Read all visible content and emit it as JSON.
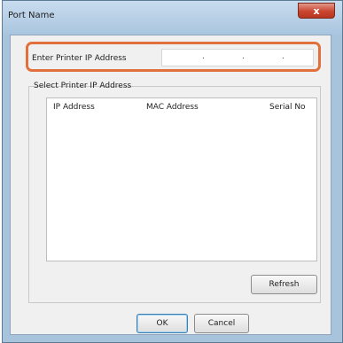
{
  "window": {
    "title": "Port Name",
    "close_glyph": "x"
  },
  "ip_entry": {
    "label": "Enter Printer IP Address",
    "separators": [
      ".",
      ".",
      "."
    ]
  },
  "select_group": {
    "label": "Select Printer IP Address",
    "columns": [
      "IP Address",
      "MAC Address",
      "Serial No"
    ],
    "rows": []
  },
  "buttons": {
    "refresh": "Refresh",
    "ok": "OK",
    "cancel": "Cancel"
  },
  "colors": {
    "highlight": "#e2703c",
    "close_button": "#c9452f"
  }
}
